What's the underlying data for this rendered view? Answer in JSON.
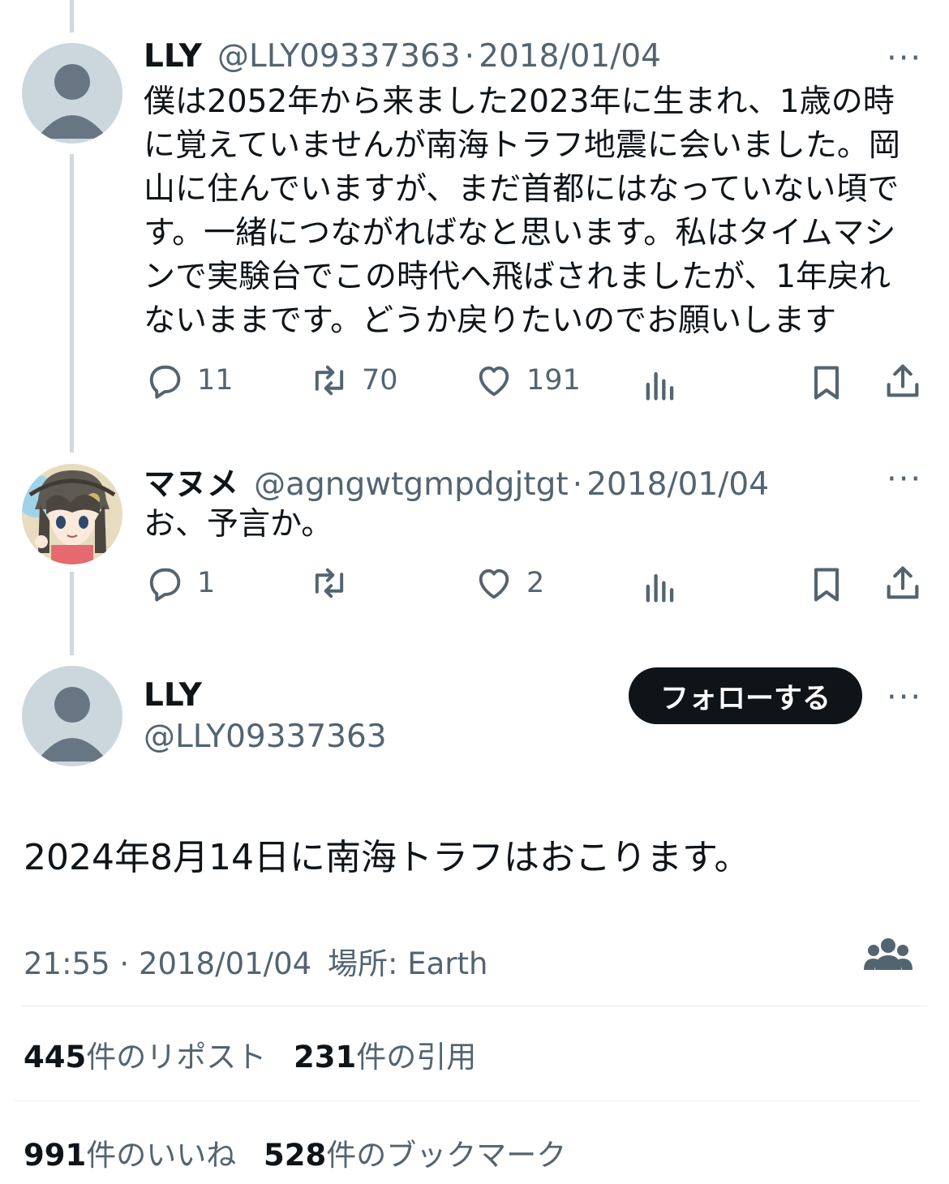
{
  "reply1": {
    "name": "LLY",
    "handle": "@LLY09337363",
    "sep": "·",
    "date": "2018/01/04",
    "more": "···",
    "lines": [
      "僕は2052年から来ました2023年に生まれ、1歳の時",
      "に覚えていませんが南海トラフ地震に会いました。岡",
      "山に住んでいますが、まだ首都にはなっていない頃で",
      "す。一緒につながればなと思います。私はタイムマシ",
      "ンで実験台でこの時代へ飛ばされましたが、1年戻れ",
      "ないままです。どうか戻りたいのでお願いします"
    ],
    "replies": "11",
    "reposts": "70",
    "likes": "191"
  },
  "reply2": {
    "name": "マヌメ",
    "handle": "@agngwtgmpdgjtgt",
    "sep": "·",
    "date": "2018/01/04",
    "more": "···",
    "text": "お、予言か。",
    "replies": "1",
    "reposts": "",
    "likes": "2"
  },
  "main": {
    "name": "LLY",
    "handle": "@LLY09337363",
    "follow_label": "フォローする",
    "more": "···",
    "text": "2024年8月14日に南海トラフはおこります。",
    "time": "21:55",
    "sep": "·",
    "date": "2018/01/04",
    "location": "場所: Earth",
    "stats": {
      "reposts_num": "445",
      "reposts_label": "件のリポスト",
      "quotes_num": "231",
      "quotes_label": "件の引用",
      "likes_num": "991",
      "likes_label": "件のいいね",
      "bookmarks_num": "528",
      "bookmarks_label": "件のブックマーク"
    }
  },
  "icons": {
    "reply": "reply-icon",
    "repost": "repost-icon",
    "like": "heart-icon",
    "views": "views-icon",
    "bookmark": "bookmark-icon",
    "share": "share-icon",
    "audience": "community-icon"
  },
  "colors": {
    "text": "#0f1419",
    "secondary": "#536471",
    "thread_line": "#cfd9de",
    "button": "#0f1419"
  }
}
